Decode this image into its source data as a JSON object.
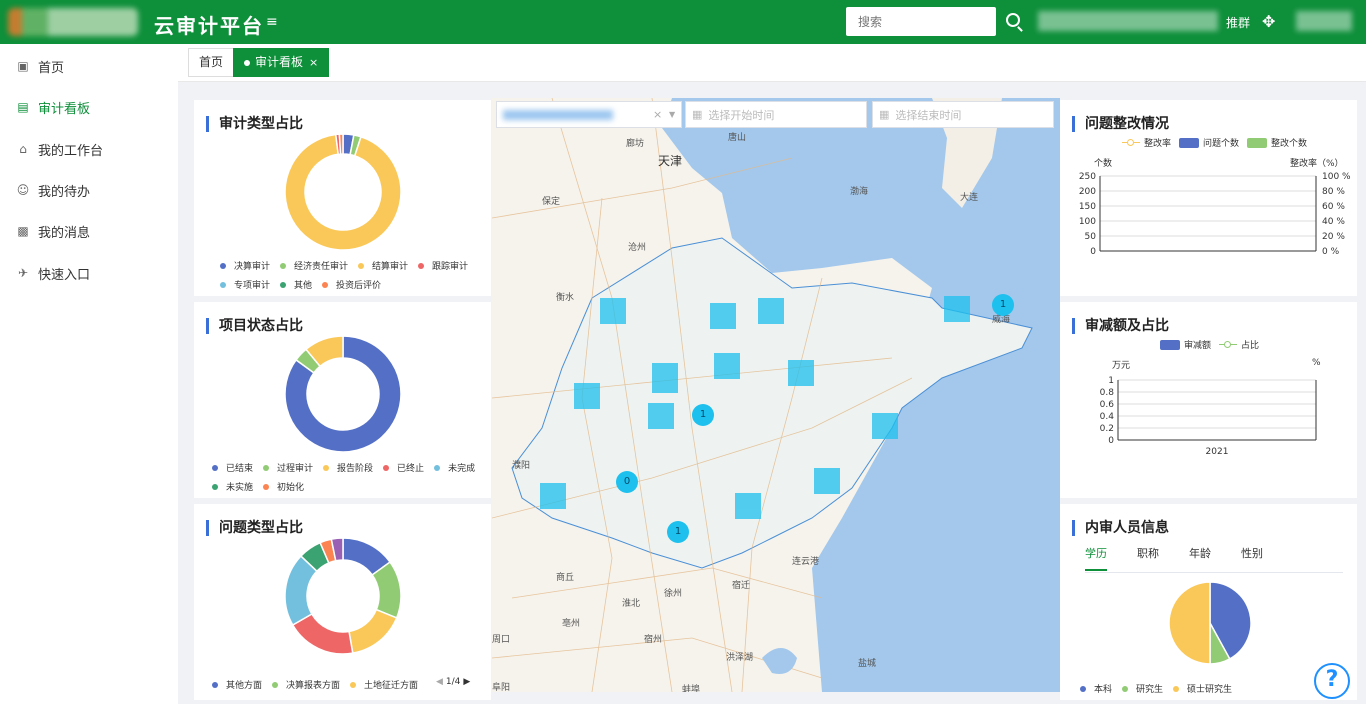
{
  "header": {
    "title": "云审计平台",
    "search_placeholder": "搜索",
    "user_suffix": "推群"
  },
  "sidebar": {
    "items": [
      {
        "label": "首页",
        "icon": "home-screen-icon"
      },
      {
        "label": "审计看板",
        "icon": "area-chart-icon"
      },
      {
        "label": "我的工作台",
        "icon": "house-icon"
      },
      {
        "label": "我的待办",
        "icon": "user-icon"
      },
      {
        "label": "我的消息",
        "icon": "id-card-icon"
      },
      {
        "label": "快速入口",
        "icon": "plane-icon"
      }
    ]
  },
  "tabs": [
    {
      "label": "首页"
    },
    {
      "label": "审计看板",
      "close": "×"
    }
  ],
  "filters": {
    "clear": "×",
    "start_placeholder": "选择开始时间",
    "end_placeholder": "选择结束时间"
  },
  "map": {
    "cities": [
      "唐山",
      "廊坊",
      "天津",
      "保定",
      "渤海",
      "大连",
      "沧州",
      "衡水",
      "威海",
      "濮阳",
      "连云港",
      "商丘",
      "徐州",
      "宿迁",
      "亳州",
      "宿州",
      "淮北",
      "蚌埠",
      "盐城",
      "周口",
      "洪泽湖",
      "阜阳"
    ],
    "bubbles": [
      "1",
      "1",
      "0",
      "1"
    ]
  },
  "colors": {
    "brand": "#0e8f3a",
    "accent_blue": "#3a6fd8"
  },
  "chart_data": [
    {
      "type": "pie",
      "title": "审计类型占比",
      "categories": [
        "决算审计",
        "经济责任审计",
        "结算审计",
        "跟踪审计",
        "专项审计",
        "其他",
        "投资后评价"
      ],
      "values": [
        3,
        2,
        93,
        1,
        0,
        0,
        1
      ],
      "colors": [
        "#5470c6",
        "#91cc75",
        "#fac858",
        "#ee6666",
        "#73c0de",
        "#3ba272",
        "#fc8452"
      ]
    },
    {
      "type": "pie",
      "title": "项目状态占比",
      "categories": [
        "已结束",
        "过程审计",
        "报告阶段",
        "已终止",
        "未完成",
        "未实施",
        "初始化"
      ],
      "values": [
        85,
        4,
        11,
        0,
        0,
        0,
        0
      ],
      "colors": [
        "#5470c6",
        "#91cc75",
        "#fac858",
        "#ee6666",
        "#73c0de",
        "#3ba272",
        "#fc8452"
      ]
    },
    {
      "type": "pie",
      "title": "问题类型占比",
      "categories": [
        "其他方面",
        "决算报表方面",
        "土地征迁方面"
      ],
      "values": [
        14,
        15,
        15,
        18,
        19,
        6,
        3,
        3
      ],
      "colors": [
        "#5470c6",
        "#91cc75",
        "#fac858",
        "#ee6666",
        "#73c0de",
        "#3ba272",
        "#fc8452",
        "#9a60b4"
      ],
      "legend_page": "1/4"
    },
    {
      "type": "bar",
      "title": "问题整改情况",
      "series": [
        {
          "name": "整改率"
        },
        {
          "name": "问题个数"
        },
        {
          "name": "整改个数"
        }
      ],
      "ylabel": "个数",
      "y2label": "整改率（%）",
      "yticks": [
        "250",
        "200",
        "150",
        "100",
        "50",
        "0"
      ],
      "y2ticks": [
        "100 %",
        "80 %",
        "60 %",
        "40 %",
        "20 %",
        "0 %"
      ],
      "ylim": [
        0,
        250
      ]
    },
    {
      "type": "bar",
      "title": "审减额及占比",
      "series": [
        {
          "name": "审减额"
        },
        {
          "name": "占比"
        }
      ],
      "ylabel": "万元",
      "y2label": "%",
      "categories": [
        "2021"
      ],
      "yticks": [
        "1",
        "0.8",
        "0.6",
        "0.4",
        "0.2",
        "0"
      ],
      "ylim": [
        0,
        1
      ]
    },
    {
      "type": "pie",
      "title": "内审人员信息",
      "tabs": [
        "学历",
        "职称",
        "年龄",
        "性别"
      ],
      "categories": [
        "本科",
        "研究生",
        "硕士研究生"
      ],
      "values": [
        42,
        8,
        50
      ],
      "colors": [
        "#5470c6",
        "#91cc75",
        "#fac858"
      ]
    }
  ]
}
